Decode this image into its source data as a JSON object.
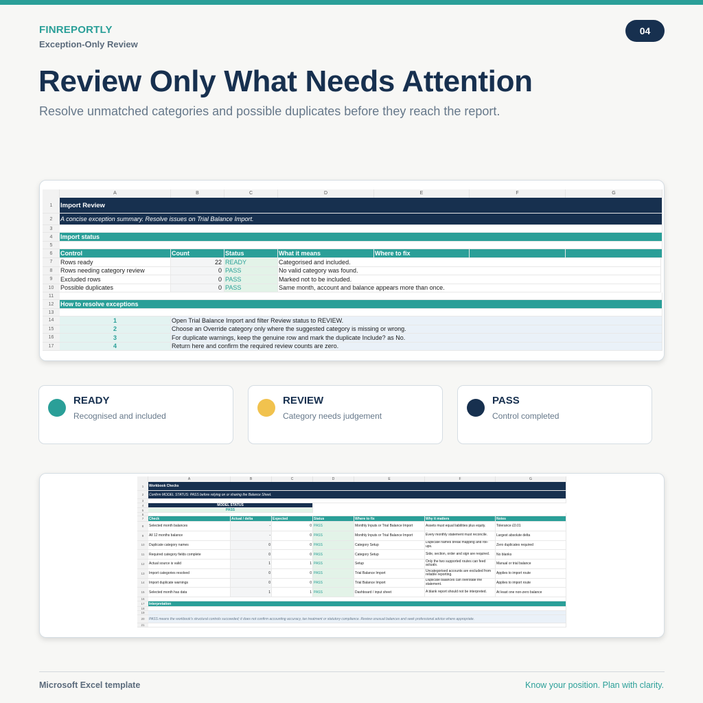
{
  "brand": "FINREPORTLY",
  "section": "Exception-Only Review",
  "page_number": "04",
  "title": "Review Only What Needs Attention",
  "subtitle": "Resolve unmatched categories and possible duplicates before they reach the report.",
  "colors": {
    "teal": "#2a9f98",
    "navy": "#17304f",
    "amber": "#f1c24e"
  },
  "sheet1": {
    "col_letters": [
      "A",
      "B",
      "C",
      "D",
      "E",
      "F",
      "G"
    ],
    "row_numbers": [
      "1",
      "2",
      "3",
      "4",
      "5",
      "6",
      "7",
      "8",
      "9",
      "10",
      "11",
      "12",
      "13",
      "14",
      "15",
      "16",
      "17"
    ],
    "title": "Import Review",
    "note": "A concise exception summary. Resolve issues on Trial Balance Import.",
    "status_header": "Import status",
    "table_headers": [
      "Control",
      "Count",
      "Status",
      "What it means",
      "Where to fix"
    ],
    "rows": [
      {
        "control": "Rows ready",
        "count": "22",
        "status": "READY",
        "meaning": "Categorised and included."
      },
      {
        "control": "Rows needing category review",
        "count": "0",
        "status": "PASS",
        "meaning": "No valid category was found."
      },
      {
        "control": "Excluded rows",
        "count": "0",
        "status": "PASS",
        "meaning": "Marked not to be included."
      },
      {
        "control": "Possible duplicates",
        "count": "0",
        "status": "PASS",
        "meaning": "Same month, account and balance appears more than once."
      }
    ],
    "resolve_header": "How to resolve exceptions",
    "steps": [
      {
        "n": "1",
        "text": "Open Trial Balance Import and filter Review status to REVIEW."
      },
      {
        "n": "2",
        "text": "Choose an Override category only where the suggested category is missing or wrong."
      },
      {
        "n": "3",
        "text": "For duplicate warnings, keep the genuine row and mark the duplicate Include? as No."
      },
      {
        "n": "4",
        "text": "Return here and confirm the required review counts are zero."
      }
    ]
  },
  "legend": [
    {
      "title": "READY",
      "subtitle": "Recognised and included",
      "color": "#2a9f98"
    },
    {
      "title": "REVIEW",
      "subtitle": "Category needs judgement",
      "color": "#f1c24e"
    },
    {
      "title": "PASS",
      "subtitle": "Control completed",
      "color": "#17304f"
    }
  ],
  "sheet2": {
    "col_letters": [
      "A",
      "B",
      "C",
      "D",
      "E",
      "F",
      "G"
    ],
    "title": "Workbook Checks",
    "note": "Confirm MODEL STATUS: PASS before relying on or sharing the Balance Sheet.",
    "model_status_label": "MODEL STATUS",
    "model_status_value": "PASS",
    "headers": [
      "Check",
      "Actual / delta",
      "Expected",
      "Status",
      "Where to fix",
      "Why it matters",
      "Notes"
    ],
    "rows": [
      {
        "check": "Selected month balances",
        "actual": "-",
        "expected": "0",
        "status": "PASS",
        "fix": "Monthly Inputs or Trial Balance Import",
        "why": "Assets must equal liabilities plus equity.",
        "notes": "Tolerance £0.01"
      },
      {
        "check": "All 12 months balance",
        "actual": "-",
        "expected": "0",
        "status": "PASS",
        "fix": "Monthly Inputs or Trial Balance Import",
        "why": "Every monthly statement must reconcile.",
        "notes": "Largest absolute delta"
      },
      {
        "check": "Duplicate category names",
        "actual": "0",
        "expected": "0",
        "status": "PASS",
        "fix": "Category Setup",
        "why": "Duplicate names break mapping and roll-ups.",
        "notes": "Zero duplicates required"
      },
      {
        "check": "Required category fields complete",
        "actual": "0",
        "expected": "0",
        "status": "PASS",
        "fix": "Category Setup",
        "why": "Side, section, order and sign are required.",
        "notes": "No blanks"
      },
      {
        "check": "Actual source is valid",
        "actual": "1",
        "expected": "1",
        "status": "PASS",
        "fix": "Setup",
        "why": "Only the two supported routes can feed actuals.",
        "notes": "Manual or trial balance"
      },
      {
        "check": "Import categories resolved",
        "actual": "0",
        "expected": "0",
        "status": "PASS",
        "fix": "Trial Balance Import",
        "why": "Uncategorised accounts are excluded from reliable reporting.",
        "notes": "Applies to import route"
      },
      {
        "check": "Import duplicate warnings",
        "actual": "0",
        "expected": "0",
        "status": "PASS",
        "fix": "Trial Balance Import",
        "why": "Duplicate balances can overstate the statement.",
        "notes": "Applies to import route"
      },
      {
        "check": "Selected month has data",
        "actual": "1",
        "expected": "1",
        "status": "PASS",
        "fix": "Dashboard / input sheet",
        "why": "A blank report should not be interpreted.",
        "notes": "At least one non-zero balance"
      }
    ],
    "interpretation_header": "Interpretation",
    "interpretation": "PASS means the workbook's structural controls succeeded; it does not confirm accounting accuracy, tax treatment or statutory compliance. Review unusual balances and seek professional advice where appropriate."
  },
  "footer": {
    "left": "Microsoft Excel template",
    "right": "Know your position. Plan with clarity."
  }
}
